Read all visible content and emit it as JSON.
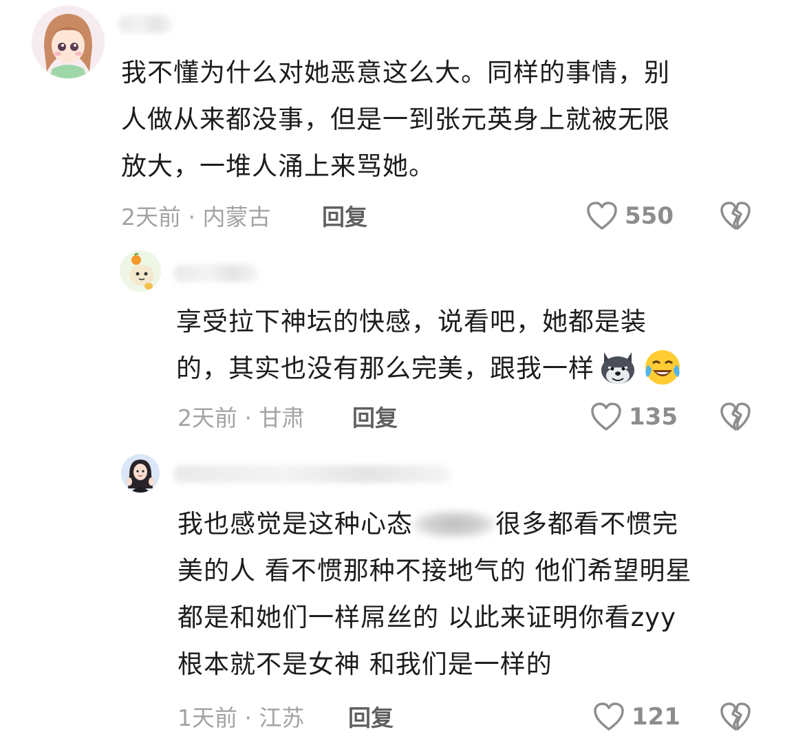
{
  "comments": [
    {
      "text_lines": [
        "我不懂为什么对她恶意这么大。同样的事情，别",
        "人做从来都没事，但是一到张元英身上就被无限",
        "放大，一堆人涌上来骂她。"
      ],
      "meta": "2天前 · 内蒙古",
      "reply_label": "回复",
      "likes": "550"
    },
    {
      "text_lines": [
        "享受拉下神坛的快感，说看吧，她都是装",
        "的，其实也没有那么完美，跟我一样"
      ],
      "meta": "2天前 · 甘肃",
      "reply_label": "回复",
      "likes": "135",
      "emojis": [
        "wolf-emoji",
        "laugh-cry-emoji"
      ]
    },
    {
      "text_lines": [
        "我也感觉是这种心态",
        "很多都看不惯完",
        "美的人 看不惯那种不接地气的 他们希望明星",
        "都是和她们一样屌丝的 以此来证明你看zyy",
        "根本就不是女神 和我们是一样的"
      ],
      "meta": "1天前 · 江苏",
      "reply_label": "回复",
      "likes": "121"
    }
  ],
  "icons": {
    "like": "heart-outline-icon",
    "dislike": "broken-heart-icon"
  },
  "colors": {
    "text": "#1c1c1c",
    "meta": "#a3a3a3",
    "reply": "#606060",
    "icon": "#8d8d8d"
  }
}
